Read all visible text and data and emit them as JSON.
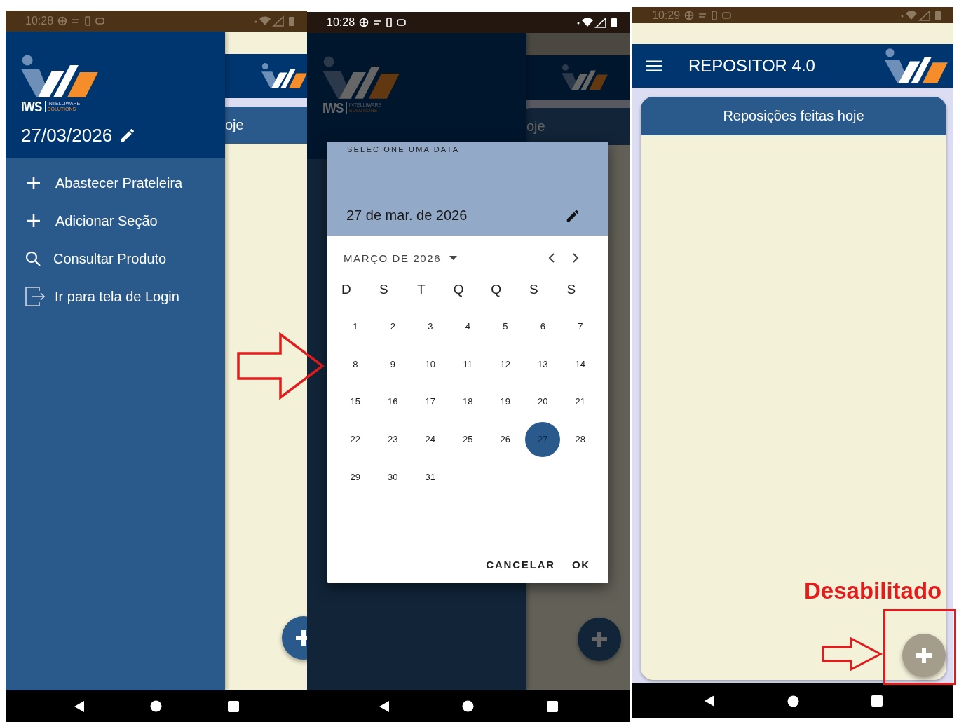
{
  "screens": [
    {
      "kind": "drawer",
      "dimmed": false,
      "status_time": "10:28",
      "drawer": {
        "logo": {
          "brand": "IWS",
          "tagline_1": "INTELLIWARE",
          "tagline_2": "SOLUTIONS"
        },
        "date": "27/03/2026",
        "items": [
          {
            "kind": "plus",
            "label": "Abastecer Prateleira"
          },
          {
            "kind": "plus",
            "label": "Adicionar Seção"
          },
          {
            "kind": "search",
            "label": "Consultar Produto"
          },
          {
            "kind": "logout",
            "label": "Ir para tela de Login"
          }
        ]
      },
      "behind": {
        "card_title": "oje"
      },
      "fab": {
        "disabled": false
      }
    },
    {
      "kind": "drawer",
      "dimmed": true,
      "status_time": "10:28",
      "drawer": {
        "logo": {
          "brand": "IWS",
          "tagline_1": "INTELLIWARE",
          "tagline_2": "SOLUTIONS"
        }
      },
      "behind": {
        "card_title": "oje"
      },
      "fab": {
        "disabled": false
      },
      "date_picker": {
        "title": "SELECIONE UMA DATA",
        "selected_date": "27 de mar. de 2026",
        "month": "MARÇO DE 2026",
        "weekdays": [
          "D",
          "S",
          "T",
          "Q",
          "Q",
          "S",
          "S"
        ],
        "days": [
          {
            "label": "1",
            "selected": false
          },
          {
            "label": "2",
            "selected": false
          },
          {
            "label": "3",
            "selected": false
          },
          {
            "label": "4",
            "selected": false
          },
          {
            "label": "5",
            "selected": false
          },
          {
            "label": "6",
            "selected": false
          },
          {
            "label": "7",
            "selected": false
          },
          {
            "label": "8",
            "selected": false
          },
          {
            "label": "9",
            "selected": false
          },
          {
            "label": "10",
            "selected": false
          },
          {
            "label": "11",
            "selected": false
          },
          {
            "label": "12",
            "selected": false
          },
          {
            "label": "13",
            "selected": false
          },
          {
            "label": "14",
            "selected": false
          },
          {
            "label": "15",
            "selected": false
          },
          {
            "label": "16",
            "selected": false
          },
          {
            "label": "17",
            "selected": false
          },
          {
            "label": "18",
            "selected": false
          },
          {
            "label": "19",
            "selected": false
          },
          {
            "label": "20",
            "selected": false
          },
          {
            "label": "21",
            "selected": false
          },
          {
            "label": "22",
            "selected": false
          },
          {
            "label": "23",
            "selected": false
          },
          {
            "label": "24",
            "selected": false
          },
          {
            "label": "25",
            "selected": false
          },
          {
            "label": "26",
            "selected": false
          },
          {
            "label": "27",
            "selected": true
          },
          {
            "label": "28",
            "selected": false
          },
          {
            "label": "29",
            "selected": false
          },
          {
            "label": "30",
            "selected": false
          },
          {
            "label": "31",
            "selected": false
          }
        ],
        "buttons": [
          "CANCELAR",
          "OK"
        ]
      }
    },
    {
      "kind": "home",
      "status_time": "10:29",
      "app_bar": {
        "title": "REPOSITOR 4.0"
      },
      "card": {
        "title": "Reposições feitas hoje"
      },
      "fab": {
        "disabled": true
      }
    }
  ],
  "annotation": {
    "label": "Desabilitado"
  }
}
